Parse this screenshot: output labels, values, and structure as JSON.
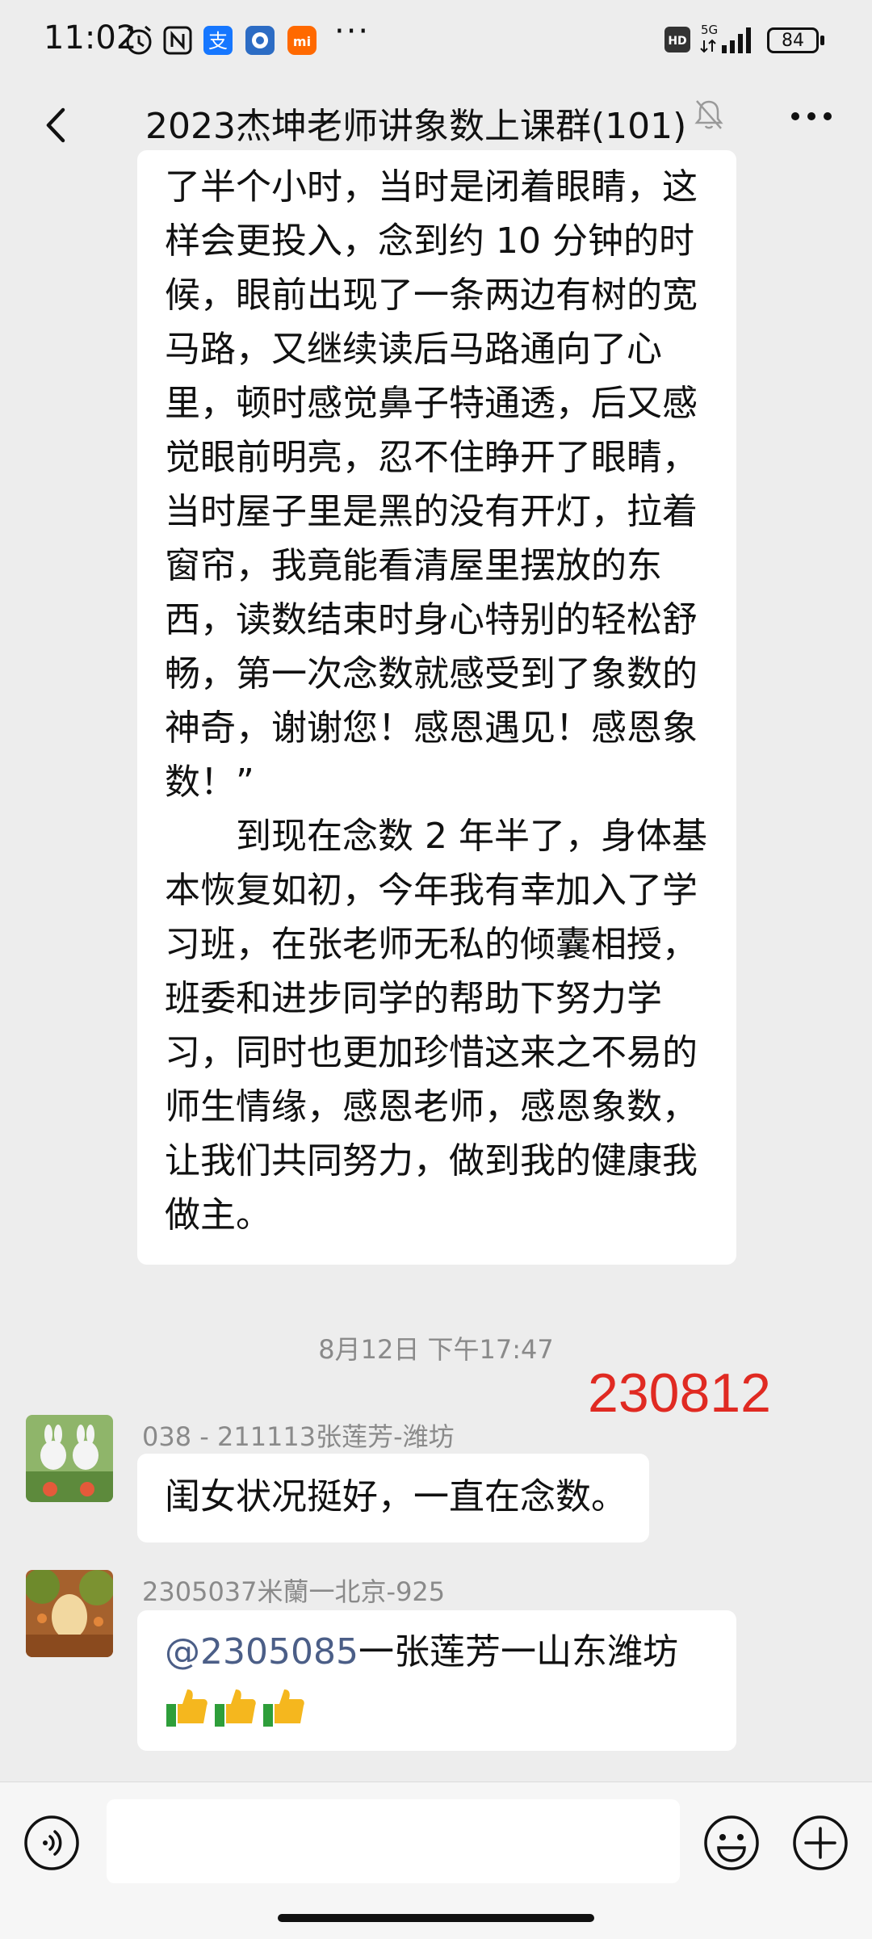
{
  "status_bar": {
    "time": "11:02",
    "network": "5G",
    "battery": "84",
    "icons": [
      "alarm-icon",
      "nfc-icon",
      "alipay-icon",
      "app-icon",
      "mi-icon"
    ],
    "more": "···"
  },
  "header": {
    "title": "2023杰坤老师讲象数上课群(101)",
    "back_icon": "chevron-left-icon",
    "mute_icon": "bell-muted-icon",
    "more_icon": "more-icon"
  },
  "messages": {
    "long_paragraph_1": "了半个小时，当时是闭着眼睛，这样会更投入，念到约 10 分钟的时候，眼前出现了一条两边有树的宽马路，又继续读后马路通向了心里，顿时感觉鼻子特通透，后又感觉眼前明亮，忍不住睁开了眼睛，当时屋子里是黑的没有开灯，拉着窗帘，我竟能看清屋里摆放的东西，读数结束时身心特别的轻松舒畅，第一次念数就感受到了象数的神奇，谢谢您！感恩遇见！感恩象数！”",
    "long_paragraph_2": "到现在念数 2 年半了，身体基本恢复如初，今年我有幸加入了学习班，在张老师无私的倾囊相授，班委和进步同学的帮助下努力学习，同时也更加珍惜这来之不易的师生情缘，感恩老师，感恩象数，让我们共同努力，做到我的健康我做主。",
    "timestamp": "8月12日 下午17:47",
    "annotation": "230812",
    "msg1_sender": "038 - 211113张莲芳-潍坊",
    "msg1_text": "闺女状况挺好，一直在念数。",
    "msg2_sender": "2305037米蘭一北京-925",
    "msg2_mention": "@2305085",
    "msg2_text": "一张莲芳一山东潍坊",
    "msg2_emoji": "thumbs-up-icon x3"
  },
  "input_bar": {
    "placeholder": "",
    "voice_icon": "voice-icon",
    "emoji_icon": "emoji-icon",
    "plus_icon": "plus-icon"
  }
}
